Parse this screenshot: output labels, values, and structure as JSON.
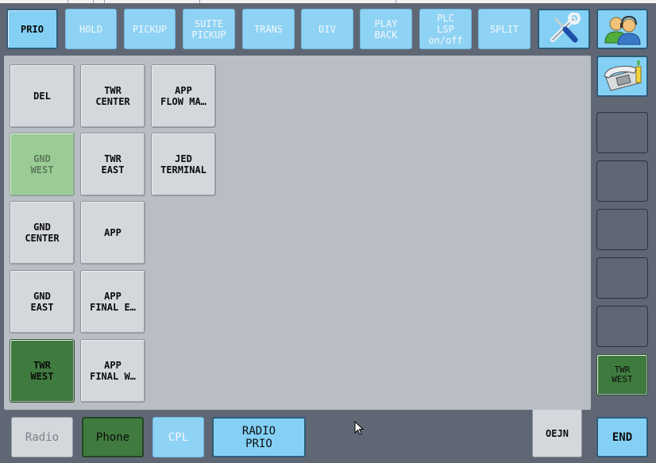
{
  "top_toolbar": [
    {
      "label": "PRIO",
      "state": "active"
    },
    {
      "label": "HOLD",
      "state": "disabled"
    },
    {
      "label": "PICKUP",
      "state": "disabled"
    },
    {
      "label": "SUITE\nPICKUP",
      "state": "disabled"
    },
    {
      "label": "TRANS",
      "state": "disabled"
    },
    {
      "label": "DIV",
      "state": "disabled"
    },
    {
      "label": "PLAY\nBACK",
      "state": "disabled"
    },
    {
      "label": "PLC\nLSP\non/off",
      "state": "disabled"
    },
    {
      "label": "SPLIT",
      "state": "disabled"
    }
  ],
  "icons": {
    "tools": "tools-icon",
    "users": "users-headset-icon",
    "phone": "telephone-icon"
  },
  "keys": {
    "del": "DEL",
    "twr_center": "TWR\nCENTER",
    "app_flow": "APP\nFLOW MA…",
    "gnd_west": "GND\nWEST",
    "twr_east": "TWR\nEAST",
    "jed_terminal": "JED\nTERMINAL",
    "gnd_center": "GND\nCENTER",
    "app": "APP",
    "gnd_east": "GND\nEAST",
    "app_final_e": "APP\nFINAL E…",
    "twr_west": "TWR\nWEST",
    "app_final_w": "APP\nFINAL W…"
  },
  "right_column": {
    "blank_slots": 5,
    "twr_west": "TWR\nWEST"
  },
  "bottom": {
    "radio": "Radio",
    "phone": "Phone",
    "cpl": "CPL",
    "radio_prio": "RADIO\nPRIO",
    "tab": "OEJN",
    "end": "END"
  },
  "colors": {
    "accent_blue": "#84d0f5",
    "active_green": "#3f7b3f",
    "dim_green": "#9ccc96",
    "key_gray": "#d4d7db",
    "panel_gray": "#b9bec5",
    "background": "#5f6775"
  }
}
